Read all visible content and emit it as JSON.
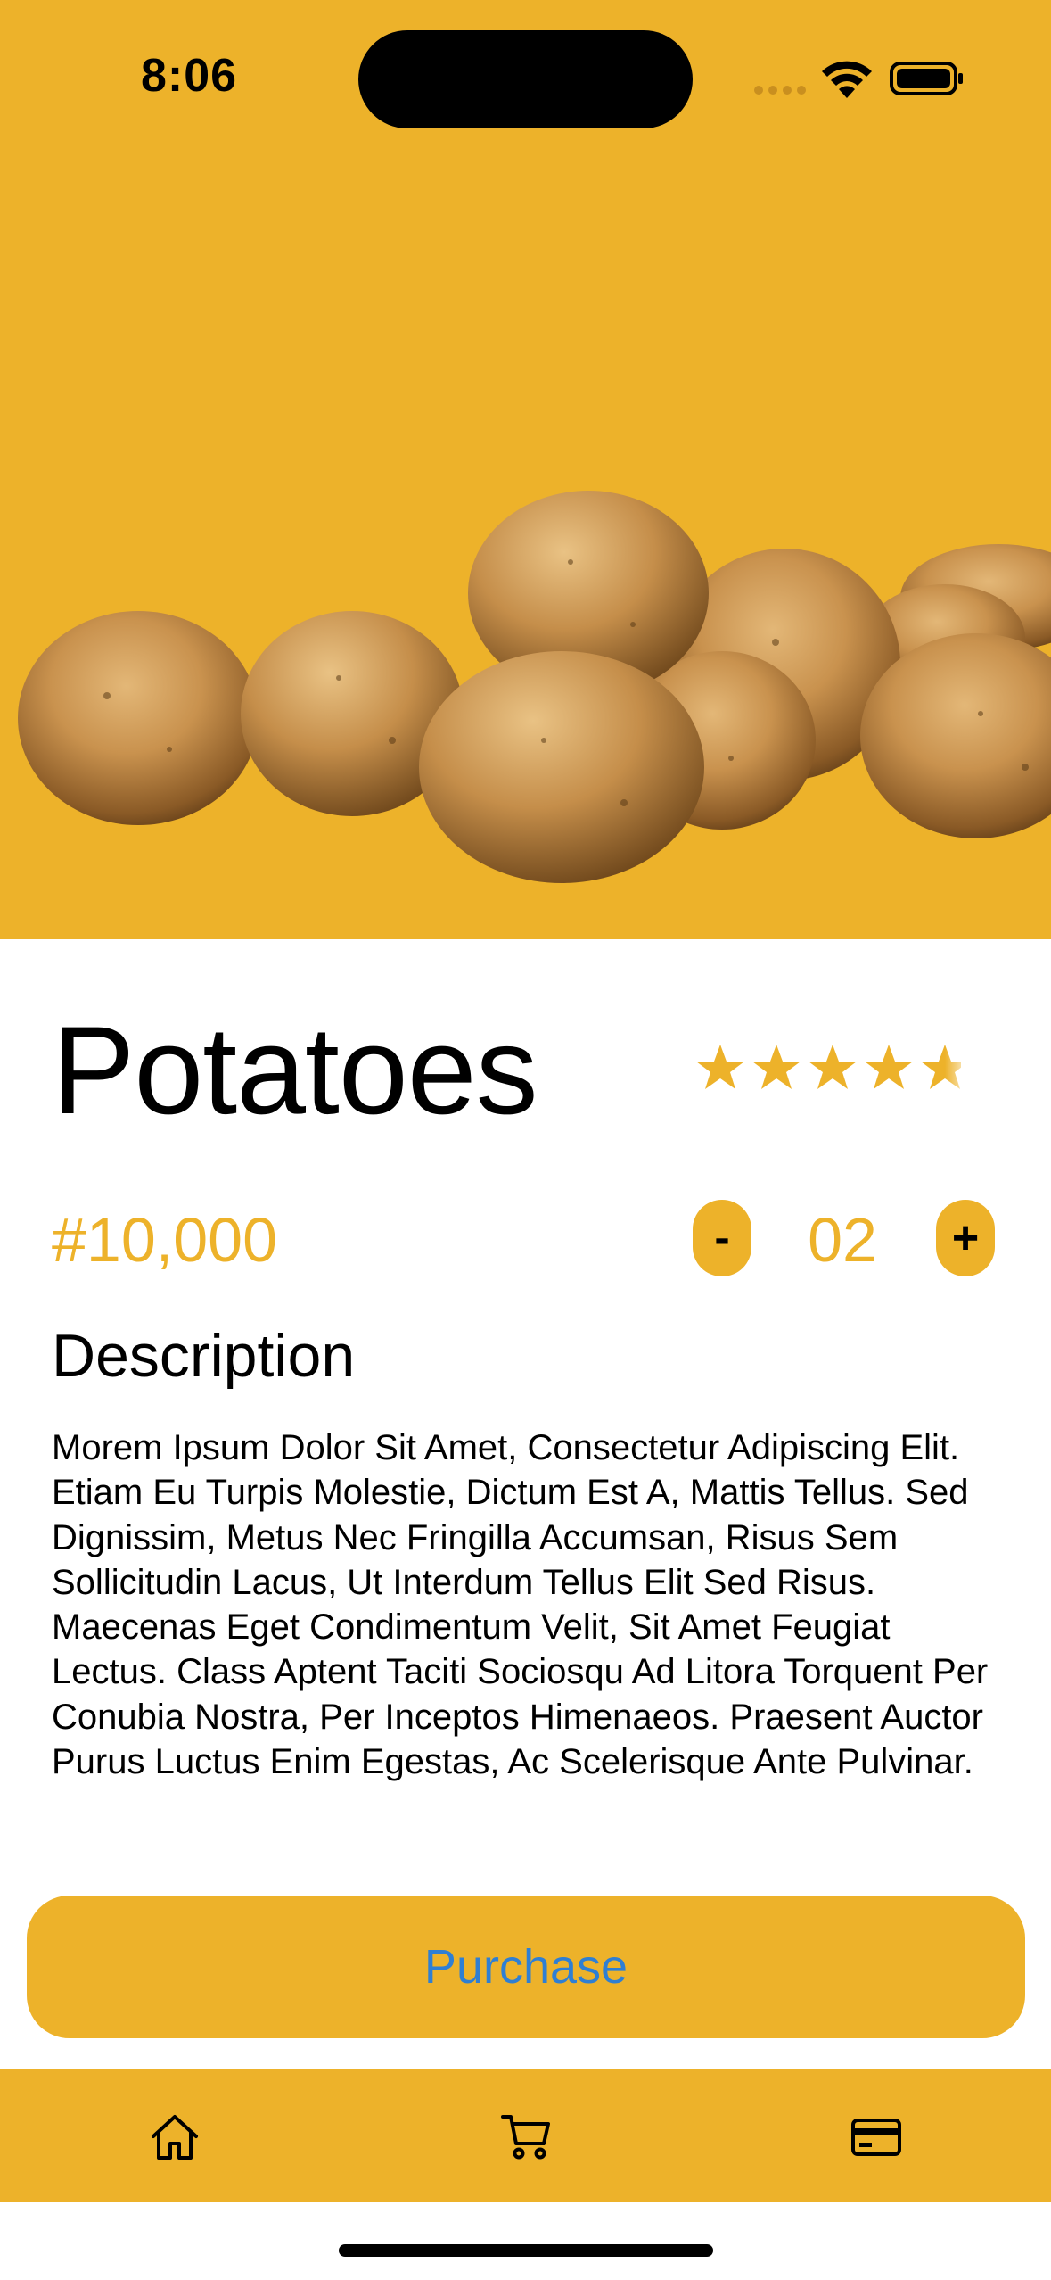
{
  "status_bar": {
    "time": "8:06"
  },
  "product": {
    "name": "Potatoes",
    "image_icon": "potatoes-image",
    "rating": 4.5,
    "rating_max": 5,
    "price": "#10,000",
    "quantity": "02",
    "minus_label": "-",
    "plus_label": "+"
  },
  "description": {
    "heading": "Description",
    "body": "Morem Ipsum Dolor Sit Amet, Consectetur Adipiscing Elit. Etiam Eu Turpis Molestie, Dictum Est A, Mattis Tellus. Sed Dignissim, Metus Nec Fringilla Accumsan, Risus Sem Sollicitudin Lacus, Ut Interdum Tellus Elit Sed Risus. Maecenas Eget Condimentum Velit, Sit Amet Feugiat Lectus. Class Aptent Taciti Sociosqu Ad Litora Torquent Per Conubia Nostra, Per Inceptos Himenaeos. Praesent Auctor Purus Luctus Enim Egestas, Ac Scelerisque Ante Pulvinar."
  },
  "actions": {
    "purchase_label": "Purchase"
  },
  "tab_bar": {
    "items": [
      {
        "icon": "home-icon"
      },
      {
        "icon": "cart-icon"
      },
      {
        "icon": "credit-card-icon"
      }
    ]
  },
  "colors": {
    "accent": "#EDB22A",
    "link": "#2F7FD3",
    "text": "#000000",
    "background": "#FFFFFF"
  }
}
